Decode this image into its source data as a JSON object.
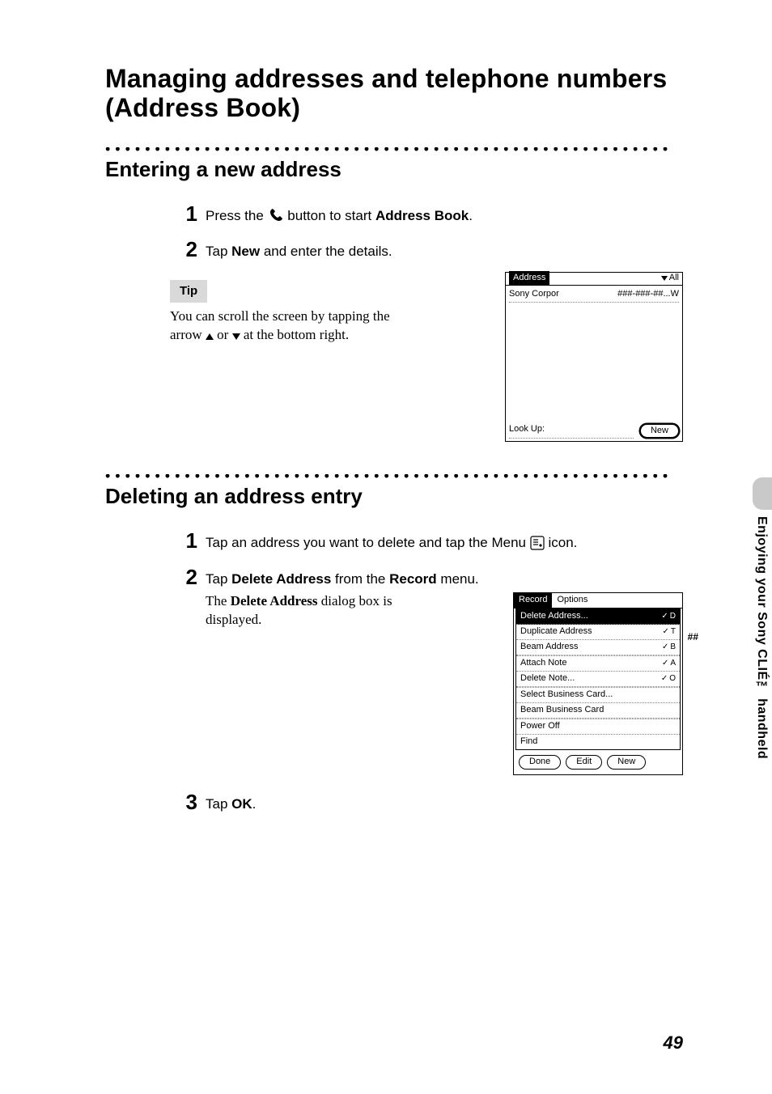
{
  "chapter_title": "Managing addresses and telephone numbers (Address Book)",
  "side_tab": "Enjoying your Sony CLIÉ™ handheld",
  "page_number": "49",
  "section1": {
    "title": "Entering a new address",
    "steps": {
      "s1": {
        "num": "1",
        "pre": "Press the ",
        "post": " button to start ",
        "bold_end": "Address Book",
        "period": "."
      },
      "s2": {
        "num": "2",
        "pre": "Tap ",
        "bold": "New",
        "post": " and enter the details."
      }
    },
    "tip_label": "Tip",
    "tip_line1": "You can scroll the screen by tapping the",
    "tip_line2_pre": "arrow ",
    "tip_line2_mid": " or ",
    "tip_line2_post": " at the bottom right.",
    "screen": {
      "title": "Address",
      "category": "All",
      "row_name": "Sony Corpor",
      "row_phone": "###-###-##...W",
      "lookup_label": "Look Up:",
      "new_btn": "New"
    }
  },
  "section2": {
    "title": "Deleting an address entry",
    "steps": {
      "s1": {
        "num": "1",
        "body_pre": "Tap an address you want to delete and tap the Menu ",
        "body_post": " icon."
      },
      "s2": {
        "num": "2",
        "body_pre": "Tap ",
        "b1": "Delete Address",
        "mid": " from the ",
        "b2": "Record",
        "post": " menu."
      },
      "s2_note_pre": "The ",
      "s2_note_bold": "Delete Address",
      "s2_note_post": " dialog box is displayed.",
      "s3": {
        "num": "3",
        "pre": "Tap ",
        "bold": "OK",
        "post": "."
      }
    },
    "menu_screen": {
      "tab_record": "Record",
      "tab_options": "Options",
      "items": {
        "delete": {
          "label": "Delete Address...",
          "key": "D"
        },
        "duplicate": {
          "label": "Duplicate Address",
          "key": "T"
        },
        "beam": {
          "label": "Beam Address",
          "key": "B"
        },
        "attach_note": {
          "label": "Attach Note",
          "key": "A"
        },
        "delete_note": {
          "label": "Delete Note...",
          "key": "O"
        },
        "select_card": {
          "label": "Select Business Card..."
        },
        "beam_card": {
          "label": "Beam Business Card"
        },
        "power_off": {
          "label": "Power Off"
        },
        "find": {
          "label": "Find"
        }
      },
      "done": "Done",
      "edit": "Edit",
      "new": "New",
      "hash": "##"
    }
  }
}
